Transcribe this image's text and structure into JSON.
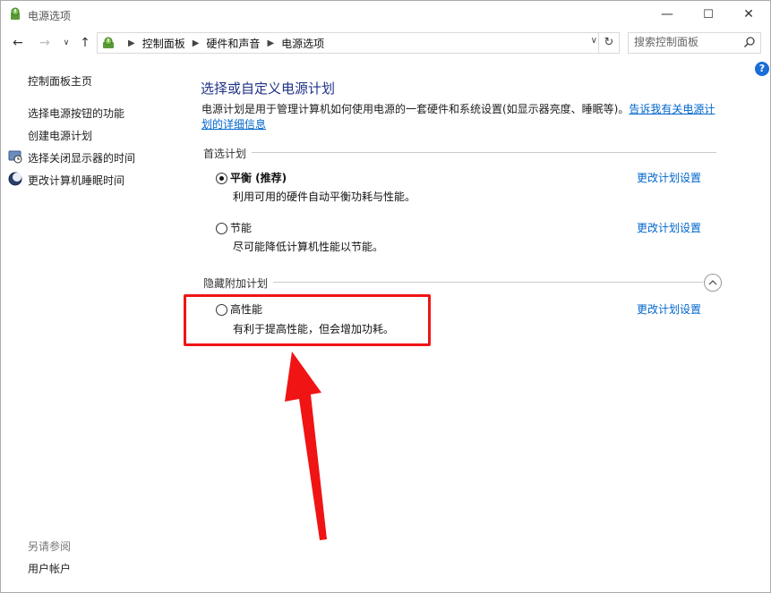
{
  "window": {
    "title": "电源选项",
    "controls": {
      "minimize": "—",
      "maximize": "☐",
      "close": "✕"
    }
  },
  "address_bar": {
    "breadcrumbs": [
      "控制面板",
      "硬件和声音",
      "电源选项"
    ],
    "search_placeholder": "搜索控制面板"
  },
  "help": {
    "label": "?"
  },
  "sidebar": {
    "home": "控制面板主页",
    "links": [
      "选择电源按钮的功能",
      "创建电源计划",
      "选择关闭显示器的时间",
      "更改计算机睡眠时间"
    ],
    "see_also_heading": "另请参阅",
    "see_also_links": [
      "用户帐户"
    ]
  },
  "main": {
    "title": "选择或自定义电源计划",
    "description": "电源计划是用于管理计算机如何使用电源的一套硬件和系统设置(如显示器亮度、睡眠等)。",
    "description_link": "告诉我有关电源计划的详细信息",
    "preferred_section": "首选计划",
    "hidden_section": "隐藏附加计划",
    "change_label": "更改计划设置",
    "plans": [
      {
        "name": "平衡 (推荐)",
        "desc": "利用可用的硬件自动平衡功耗与性能。",
        "selected": true
      },
      {
        "name": "节能",
        "desc": "尽可能降低计算机性能以节能。",
        "selected": false
      },
      {
        "name": "高性能",
        "desc": "有利于提高性能，但会增加功耗。",
        "selected": false
      }
    ]
  },
  "annotation": {
    "highlight_color": "#f01414"
  }
}
